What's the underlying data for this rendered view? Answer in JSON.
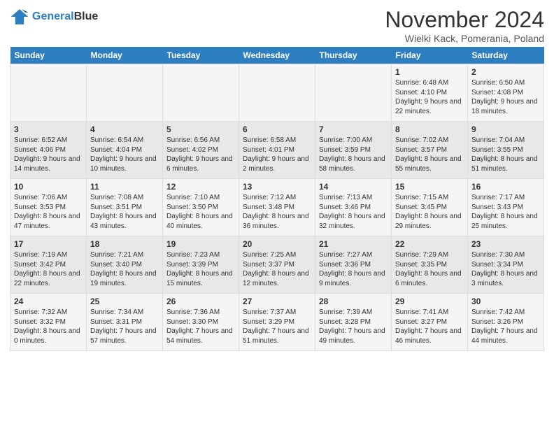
{
  "logo": {
    "line1": "General",
    "line2": "Blue"
  },
  "title": "November 2024",
  "location": "Wielki Kack, Pomerania, Poland",
  "days_of_week": [
    "Sunday",
    "Monday",
    "Tuesday",
    "Wednesday",
    "Thursday",
    "Friday",
    "Saturday"
  ],
  "weeks": [
    [
      {
        "day": "",
        "content": ""
      },
      {
        "day": "",
        "content": ""
      },
      {
        "day": "",
        "content": ""
      },
      {
        "day": "",
        "content": ""
      },
      {
        "day": "",
        "content": ""
      },
      {
        "day": "1",
        "content": "Sunrise: 6:48 AM\nSunset: 4:10 PM\nDaylight: 9 hours and 22 minutes."
      },
      {
        "day": "2",
        "content": "Sunrise: 6:50 AM\nSunset: 4:08 PM\nDaylight: 9 hours and 18 minutes."
      }
    ],
    [
      {
        "day": "3",
        "content": "Sunrise: 6:52 AM\nSunset: 4:06 PM\nDaylight: 9 hours and 14 minutes."
      },
      {
        "day": "4",
        "content": "Sunrise: 6:54 AM\nSunset: 4:04 PM\nDaylight: 9 hours and 10 minutes."
      },
      {
        "day": "5",
        "content": "Sunrise: 6:56 AM\nSunset: 4:02 PM\nDaylight: 9 hours and 6 minutes."
      },
      {
        "day": "6",
        "content": "Sunrise: 6:58 AM\nSunset: 4:01 PM\nDaylight: 9 hours and 2 minutes."
      },
      {
        "day": "7",
        "content": "Sunrise: 7:00 AM\nSunset: 3:59 PM\nDaylight: 8 hours and 58 minutes."
      },
      {
        "day": "8",
        "content": "Sunrise: 7:02 AM\nSunset: 3:57 PM\nDaylight: 8 hours and 55 minutes."
      },
      {
        "day": "9",
        "content": "Sunrise: 7:04 AM\nSunset: 3:55 PM\nDaylight: 8 hours and 51 minutes."
      }
    ],
    [
      {
        "day": "10",
        "content": "Sunrise: 7:06 AM\nSunset: 3:53 PM\nDaylight: 8 hours and 47 minutes."
      },
      {
        "day": "11",
        "content": "Sunrise: 7:08 AM\nSunset: 3:51 PM\nDaylight: 8 hours and 43 minutes."
      },
      {
        "day": "12",
        "content": "Sunrise: 7:10 AM\nSunset: 3:50 PM\nDaylight: 8 hours and 40 minutes."
      },
      {
        "day": "13",
        "content": "Sunrise: 7:12 AM\nSunset: 3:48 PM\nDaylight: 8 hours and 36 minutes."
      },
      {
        "day": "14",
        "content": "Sunrise: 7:13 AM\nSunset: 3:46 PM\nDaylight: 8 hours and 32 minutes."
      },
      {
        "day": "15",
        "content": "Sunrise: 7:15 AM\nSunset: 3:45 PM\nDaylight: 8 hours and 29 minutes."
      },
      {
        "day": "16",
        "content": "Sunrise: 7:17 AM\nSunset: 3:43 PM\nDaylight: 8 hours and 25 minutes."
      }
    ],
    [
      {
        "day": "17",
        "content": "Sunrise: 7:19 AM\nSunset: 3:42 PM\nDaylight: 8 hours and 22 minutes."
      },
      {
        "day": "18",
        "content": "Sunrise: 7:21 AM\nSunset: 3:40 PM\nDaylight: 8 hours and 19 minutes."
      },
      {
        "day": "19",
        "content": "Sunrise: 7:23 AM\nSunset: 3:39 PM\nDaylight: 8 hours and 15 minutes."
      },
      {
        "day": "20",
        "content": "Sunrise: 7:25 AM\nSunset: 3:37 PM\nDaylight: 8 hours and 12 minutes."
      },
      {
        "day": "21",
        "content": "Sunrise: 7:27 AM\nSunset: 3:36 PM\nDaylight: 8 hours and 9 minutes."
      },
      {
        "day": "22",
        "content": "Sunrise: 7:29 AM\nSunset: 3:35 PM\nDaylight: 8 hours and 6 minutes."
      },
      {
        "day": "23",
        "content": "Sunrise: 7:30 AM\nSunset: 3:34 PM\nDaylight: 8 hours and 3 minutes."
      }
    ],
    [
      {
        "day": "24",
        "content": "Sunrise: 7:32 AM\nSunset: 3:32 PM\nDaylight: 8 hours and 0 minutes."
      },
      {
        "day": "25",
        "content": "Sunrise: 7:34 AM\nSunset: 3:31 PM\nDaylight: 7 hours and 57 minutes."
      },
      {
        "day": "26",
        "content": "Sunrise: 7:36 AM\nSunset: 3:30 PM\nDaylight: 7 hours and 54 minutes."
      },
      {
        "day": "27",
        "content": "Sunrise: 7:37 AM\nSunset: 3:29 PM\nDaylight: 7 hours and 51 minutes."
      },
      {
        "day": "28",
        "content": "Sunrise: 7:39 AM\nSunset: 3:28 PM\nDaylight: 7 hours and 49 minutes."
      },
      {
        "day": "29",
        "content": "Sunrise: 7:41 AM\nSunset: 3:27 PM\nDaylight: 7 hours and 46 minutes."
      },
      {
        "day": "30",
        "content": "Sunrise: 7:42 AM\nSunset: 3:26 PM\nDaylight: 7 hours and 44 minutes."
      }
    ]
  ]
}
